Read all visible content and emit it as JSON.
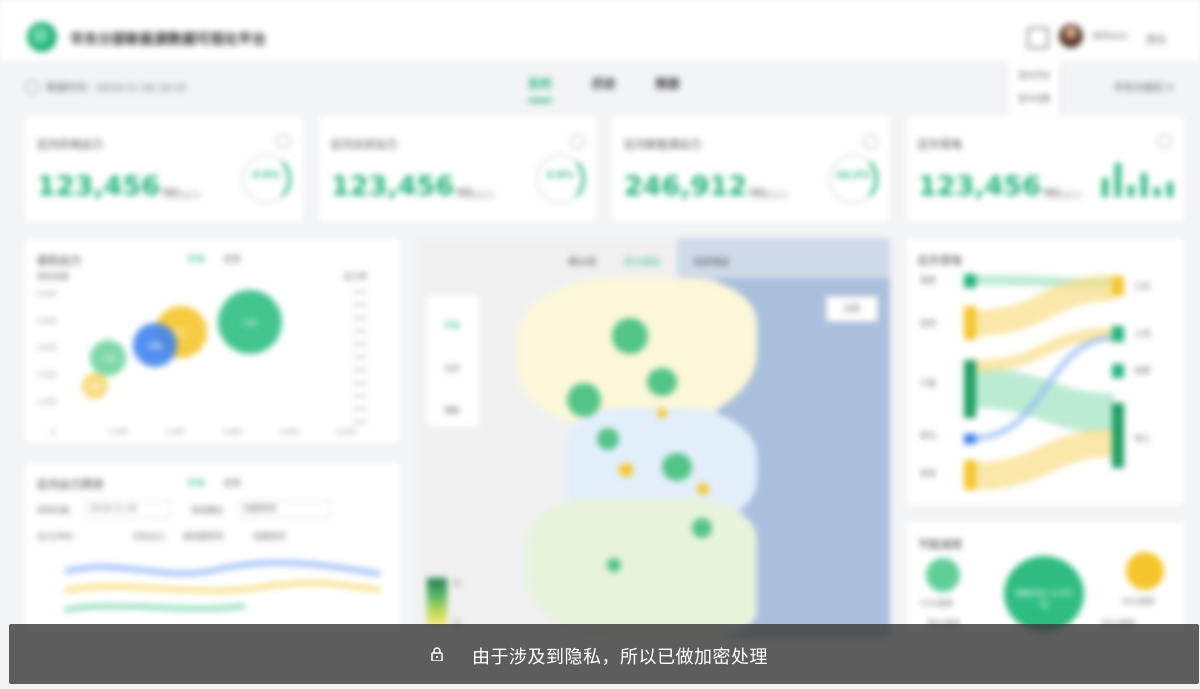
{
  "header": {
    "app_title": "华东分部新能源数据可视化平台",
    "user_name": "Willson",
    "logout_label": "退出"
  },
  "subbar": {
    "update_label": "数据时间：2019-11-18 10:15",
    "tabs": [
      "实时",
      "历史",
      "预测"
    ],
    "active_tab_index": 0,
    "dropdown_items": [
      "显示开关",
      "显示设置"
    ],
    "region_select": "华东分部区 ▾"
  },
  "kpis": [
    {
      "label": "区内风电出力",
      "value": "123,456",
      "unit": "MW",
      "sub": "占总出力",
      "ring_text": "3.9%"
    },
    {
      "label": "区内光伏出力",
      "value": "123,456",
      "unit": "MW",
      "sub": "占总出力",
      "ring_text": "3.9%"
    },
    {
      "label": "区内新能源出力",
      "value": "246,912",
      "unit": "MW",
      "sub": "占总出力",
      "ring_text": "10.2%"
    },
    {
      "label": "区外受电",
      "value": "123,456",
      "unit": "MW",
      "sub": "占总出力",
      "bars": [
        0.55,
        1.0,
        0.35,
        0.7,
        0.3,
        0.45
      ]
    }
  ],
  "bubble_panel": {
    "title": "装机出力",
    "tabs": [
      "风电",
      "光伏"
    ],
    "active_tab_index": 0,
    "ylabel": "装机容量",
    "right_label": "出力率",
    "y_ticks": [
      "8,000",
      "6,000",
      "4,000",
      "2,000",
      "1,000"
    ],
    "x_ticks": [
      "0",
      "1,000",
      "2,000",
      "3,000",
      "4,000",
      "5,000"
    ],
    "bubble_labels": [
      "江苏",
      "浙江",
      "安徽",
      "上海",
      "福建"
    ]
  },
  "forecast_panel": {
    "title": "区内出力预测",
    "tabs": [
      "风电",
      "光伏"
    ],
    "active_tab_index": 0,
    "date_label": "预测日期",
    "date_value": "2019-11-18",
    "model_label": "预测模型",
    "model_value": "短期预测",
    "ylabel": "出力(MW)",
    "legend": [
      "实际出力",
      "超短期预测",
      "短期预测"
    ],
    "colors": [
      "#5fcf98",
      "#f5cf4a",
      "#6c9ff5"
    ]
  },
  "map": {
    "tabs": [
      "新公司",
      "风力场站",
      "光伏场站"
    ],
    "active_tab_index": 1,
    "legend_items": [
      "风电",
      "光伏",
      "储能"
    ],
    "select_value": "全部",
    "scale_labels": [
      "大",
      "小"
    ]
  },
  "sankey": {
    "title": "区外受电",
    "sources": [
      {
        "name": "锦屏",
        "value": "1234.5 MW"
      },
      {
        "name": "宜宾",
        "value": "1234.5 MW"
      },
      {
        "name": "宁夏",
        "value": "1234.5 MW"
      },
      {
        "name": "晋北",
        "value": "1234.5 MW"
      },
      {
        "name": "其他",
        "value": "1234.5 MW"
      }
    ],
    "targets": [
      {
        "name": "江苏",
        "value": "1234.5 MW"
      },
      {
        "name": "上海",
        "value": "1234.5 MW"
      },
      {
        "name": "安徽",
        "value": "1234.5 MW"
      },
      {
        "name": "浙江",
        "value": "1234.5 MW"
      }
    ]
  },
  "energy_panel": {
    "title": "节能减排",
    "items": [
      "CO2减排",
      "煤耗节约 123万吨",
      "SO2减排",
      "粉尘减排",
      "NOx减排"
    ]
  },
  "privacy": {
    "text": "由于涉及到隐私，所以已做加密处理"
  }
}
